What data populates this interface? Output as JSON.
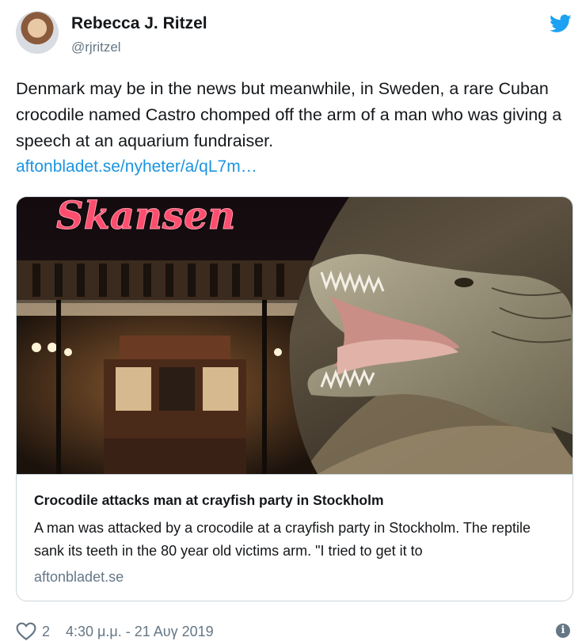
{
  "author": {
    "display_name": "Rebecca J. Ritzel",
    "handle": "@rjritzel"
  },
  "tweet": {
    "text": "Denmark may be in the news but meanwhile, in Sweden, a rare Cuban crocodile named Castro chomped off the arm of a man who was giving a speech at an aquarium fundraiser.",
    "link_text": "aftonbladet.se/nyheter/a/qL7m…"
  },
  "card": {
    "image_sign_text": "Skansen",
    "title": "Crocodile attacks man at crayfish party in Stockholm",
    "description": "A man was attacked by a crocodile at a crayfish party in Stockholm. The reptile sank its teeth in the 80 year old victims arm. \"I tried to get it to",
    "domain": "aftonbladet.se"
  },
  "footer": {
    "like_count": "2",
    "timestamp": "4:30 μ.μ. - 21 Αυγ 2019",
    "info_glyph": "i"
  },
  "icons": {
    "brand": "twitter-bird-icon",
    "like": "heart-icon",
    "info": "info-icon"
  },
  "colors": {
    "link": "#1b95e0",
    "twitter_blue": "#1da1f2",
    "secondary_text": "#657786",
    "border": "#ccd6dd",
    "neon_sign": "#ff4d6d"
  }
}
